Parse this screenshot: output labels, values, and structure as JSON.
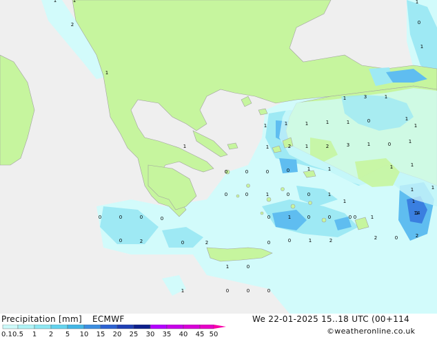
{
  "footer": {
    "title": "Precipitation [mm]",
    "model": "ECMWF",
    "valid": "We 22-01-2025 15..18 UTC (00+114",
    "credit": "©weatheronline.co.uk"
  },
  "scale": {
    "labels": [
      "0.1",
      "0.5",
      "1",
      "2",
      "5",
      "10",
      "15",
      "20",
      "25",
      "30",
      "35",
      "40",
      "45",
      "50"
    ],
    "colors": [
      "#cdfafa",
      "#aef3f6",
      "#8ee8f3",
      "#64d3ee",
      "#44b7e6",
      "#3c8ee0",
      "#2c62d2",
      "#1e3fb4",
      "#0d1f8c",
      "#b400ff",
      "#c800ea",
      "#d800d8",
      "#e800c8",
      "#f800a8"
    ]
  },
  "colors": {
    "land": "#c6f59e",
    "sea": "#efefef",
    "precip_light": "#d2fbfb",
    "precip_mid": "#9ee9f4",
    "precip_high": "#5fbdf0",
    "precip_max": "#3a7fe0"
  },
  "points": [
    "1",
    "1",
    "1",
    "1",
    "1",
    "0",
    "2",
    "1",
    "1",
    "2",
    "3",
    "1",
    "0",
    "1",
    "1",
    "3",
    "1",
    "1",
    "1",
    "1",
    "0",
    "1",
    "0",
    "0",
    "1",
    "1",
    "1",
    "1",
    "1",
    "1",
    "1",
    "1",
    "2",
    "0",
    "2",
    "0",
    "1",
    "14",
    "2",
    "1",
    "0",
    "0",
    "0",
    "1",
    "2",
    "0",
    "2",
    "0",
    "0",
    "0",
    "0",
    "0",
    "1",
    "0",
    "0",
    "0",
    "0",
    "0",
    "0",
    "0",
    "1",
    "0",
    "0",
    "1",
    "0",
    "0",
    "0",
    "1",
    "0",
    "1",
    "1",
    "2",
    "1",
    "1",
    "1"
  ]
}
